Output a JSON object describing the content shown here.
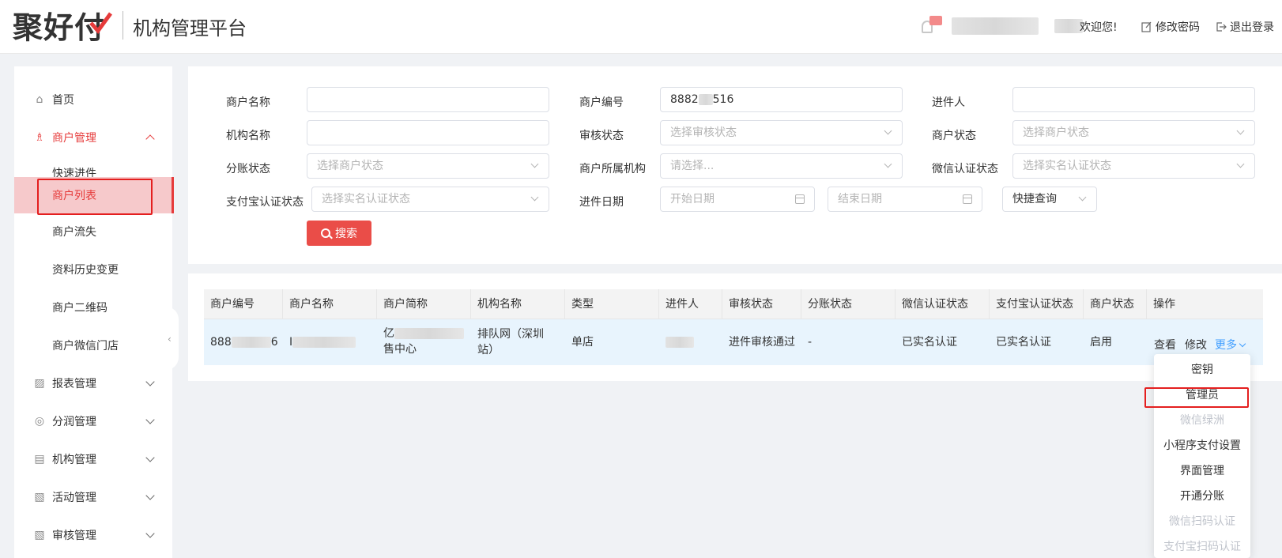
{
  "header": {
    "logo_text": "聚好付",
    "platform_title": "机构管理平台",
    "welcome": "欢迎您!",
    "change_password": "修改密码",
    "logout": "退出登录"
  },
  "sidebar": {
    "home": "首页",
    "merchant_mgmt": "商户管理",
    "sub_items": [
      "快速进件",
      "商户列表",
      "商户流失",
      "资料历史变更",
      "商户二维码",
      "商户微信门店"
    ],
    "groups": [
      "报表管理",
      "分润管理",
      "机构管理",
      "活动管理",
      "审核管理"
    ]
  },
  "search": {
    "labels": {
      "merchant_name": "商户名称",
      "merchant_no": "商户编号",
      "onboarder": "进件人",
      "org_name": "机构名称",
      "audit_status": "审核状态",
      "merchant_status": "商户状态",
      "split_status": "分账状态",
      "merchant_org": "商户所属机构",
      "wechat_auth": "微信认证状态",
      "alipay_auth": "支付宝认证状态",
      "onboard_date": "进件日期"
    },
    "merchant_no_value": "8882",
    "merchant_no_tail": "516",
    "placeholders": {
      "audit_status": "选择审核状态",
      "merchant_status": "选择商户状态",
      "split_status": "选择商户状态",
      "merchant_org": "请选择...",
      "wechat_auth": "选择实名认证状态",
      "alipay_auth": "选择实名认证状态",
      "start_date": "开始日期",
      "end_date": "结束日期"
    },
    "quick_query": "快捷查询",
    "search_button": "搜索"
  },
  "table": {
    "headers": [
      "商户编号",
      "商户名称",
      "商户简称",
      "机构名称",
      "类型",
      "进件人",
      "审核状态",
      "分账状态",
      "微信认证状态",
      "支付宝认证状态",
      "商户状态",
      "操作"
    ],
    "row": {
      "merchant_no_head": "888",
      "merchant_no_tail": "6",
      "merchant_name_head": "I",
      "short_name_head": "亿",
      "short_name_tail": "售中心",
      "org_name": "排队网（深圳站）",
      "type": "单店",
      "audit_status": "进件审核通过",
      "split_status": "-",
      "wechat_auth": "已实名认证",
      "alipay_auth": "已实名认证",
      "merchant_status": "启用"
    },
    "actions": {
      "view": "查看",
      "edit": "修改",
      "more": "更多"
    }
  },
  "dropdown": {
    "items": [
      {
        "label": "密钥",
        "disabled": false
      },
      {
        "label": "管理员",
        "disabled": false
      },
      {
        "label": "微信绿洲",
        "disabled": true
      },
      {
        "label": "小程序支付设置",
        "disabled": false
      },
      {
        "label": "界面管理",
        "disabled": false
      },
      {
        "label": "开通分账",
        "disabled": false
      },
      {
        "label": "微信扫码认证",
        "disabled": true
      },
      {
        "label": "支付宝扫码认证",
        "disabled": true
      }
    ]
  },
  "colors": {
    "accent": "#e63b3b",
    "selected_bg": "#f6c9cb",
    "link_blue": "#409eff",
    "highlight_red": "#e41f1f"
  }
}
